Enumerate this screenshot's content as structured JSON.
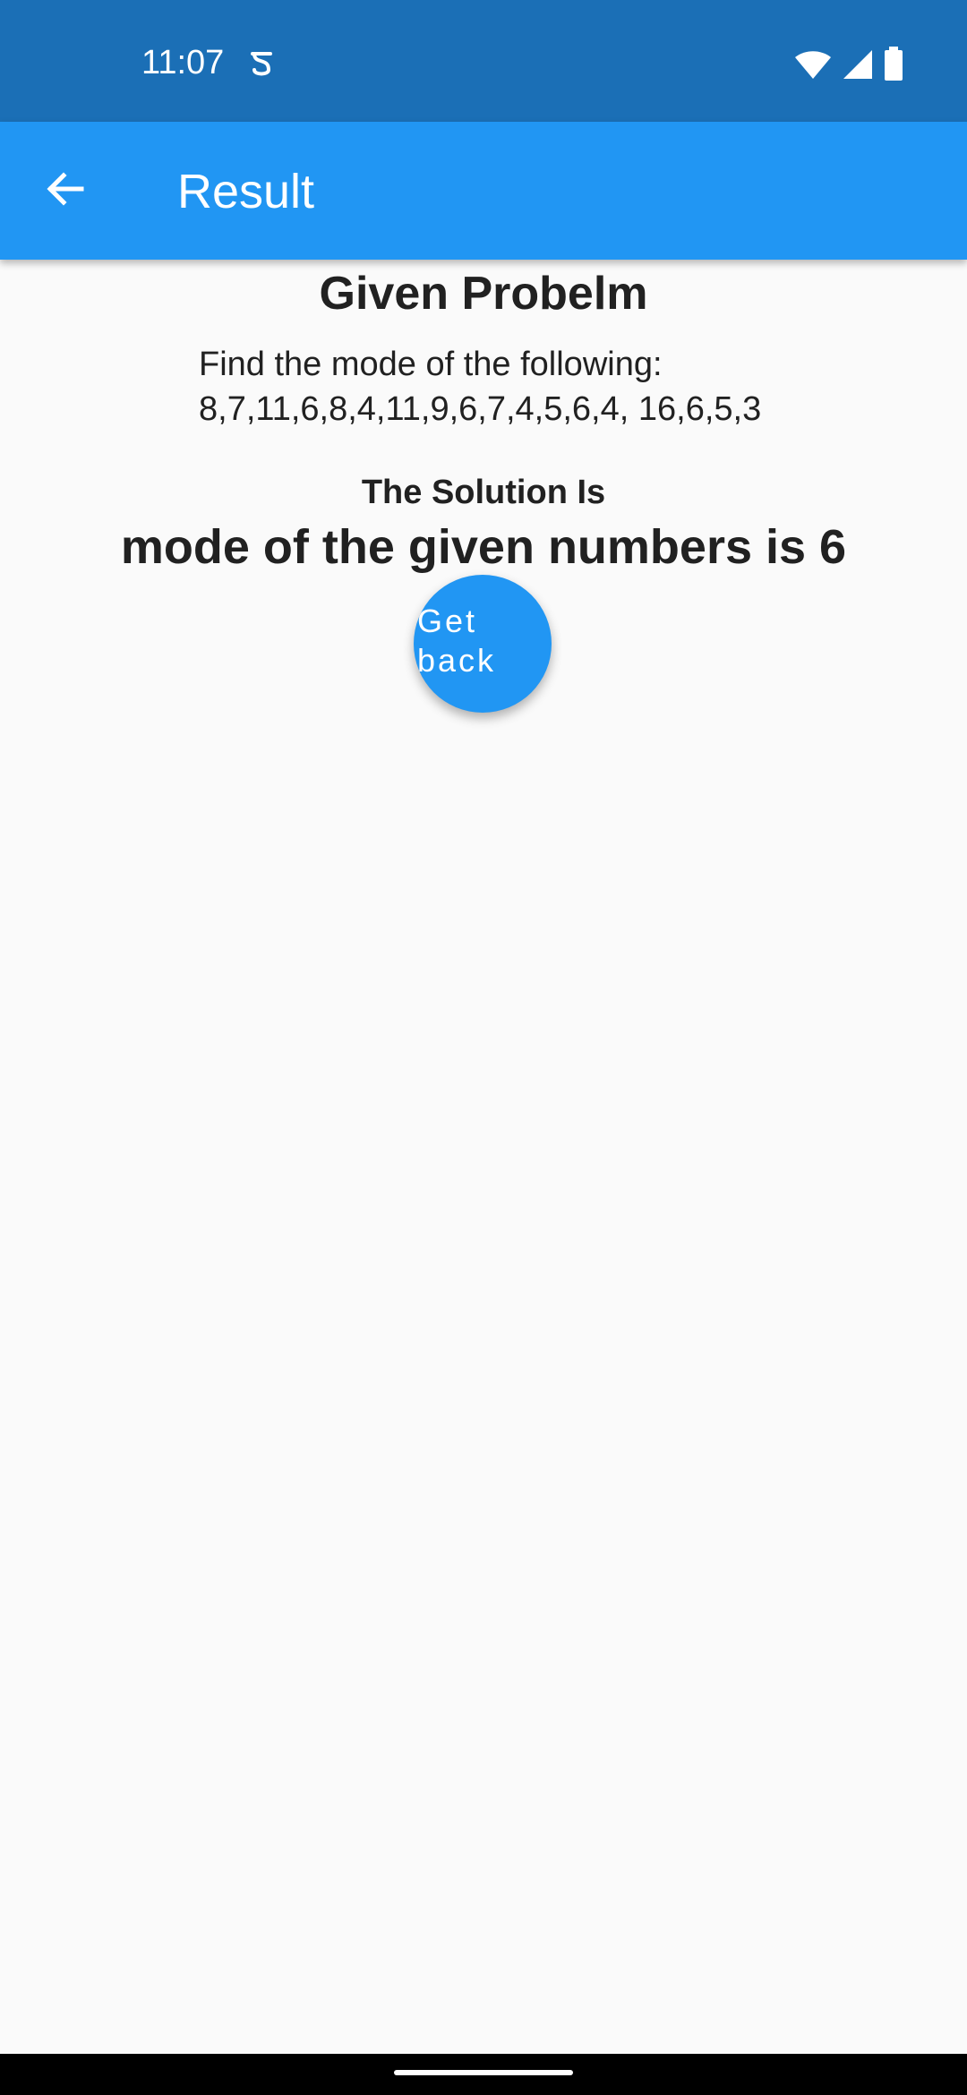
{
  "status_bar": {
    "time": "11:07",
    "icons": [
      "notification-s-icon",
      "wifi-icon",
      "signal-icon",
      "battery-icon"
    ],
    "color": "#1b6fb6"
  },
  "app_bar": {
    "title": "Result",
    "back_icon": "arrow-left-icon",
    "color": "#2196f3"
  },
  "problem": {
    "heading": "Given Probelm",
    "text": "Find the mode of the following:\n8,7,11,6,8,4,11,9,6,7,4,5,6,4, 16,6,5,3"
  },
  "solution": {
    "heading": "The Solution Is",
    "answer": "mode of the given numbers is 6"
  },
  "get_back_button": {
    "label": "Get\nback",
    "color": "#2196f3"
  }
}
